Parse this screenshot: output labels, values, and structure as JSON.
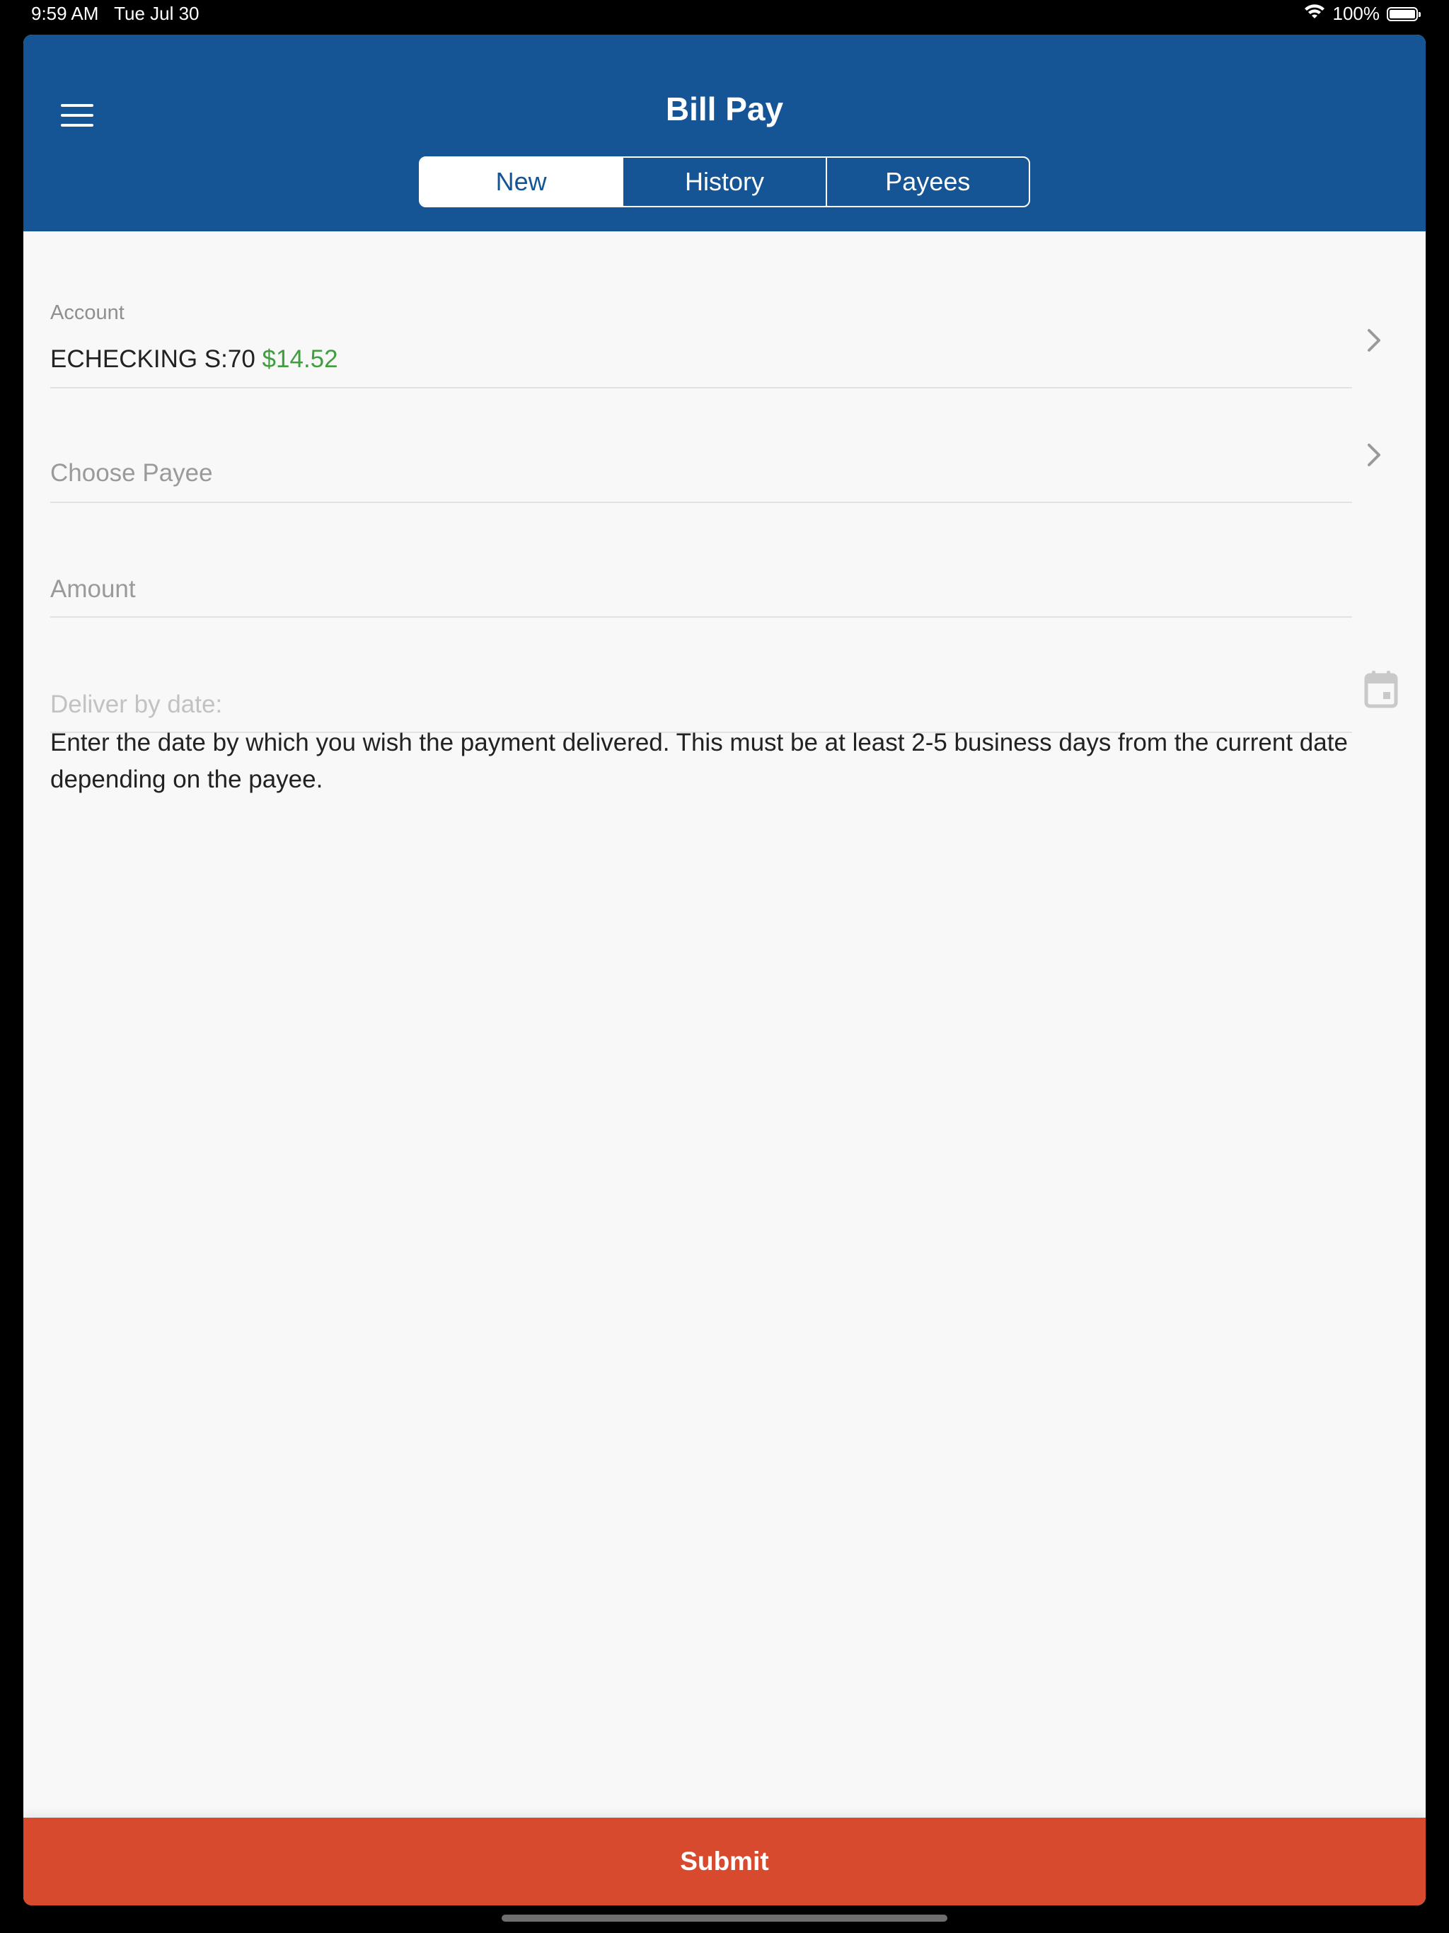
{
  "status_bar": {
    "time": "9:59 AM",
    "date": "Tue Jul 30",
    "battery": "100%",
    "battery_level": 1.0
  },
  "header": {
    "title": "Bill Pay",
    "menu_icon": "hamburger-menu-icon",
    "background_color": "#155595",
    "tabs": [
      {
        "label": "New",
        "active": true
      },
      {
        "label": "History",
        "active": false
      },
      {
        "label": "Payees",
        "active": false
      }
    ]
  },
  "form": {
    "account": {
      "label": "Account",
      "name": "ECHECKING S:70",
      "balance": "$14.52",
      "balance_color": "#3f9e3e"
    },
    "payee": {
      "placeholder": "Choose Payee"
    },
    "amount": {
      "placeholder": "Amount"
    },
    "deliver_date": {
      "placeholder": "Deliver by date:",
      "icon": "calendar-icon"
    },
    "help_text": "Enter the date by which you wish the payment delivered. This must be at least 2-5 business days from the current date depending on the payee."
  },
  "submit": {
    "label": "Submit",
    "color": "#d84a2d"
  }
}
